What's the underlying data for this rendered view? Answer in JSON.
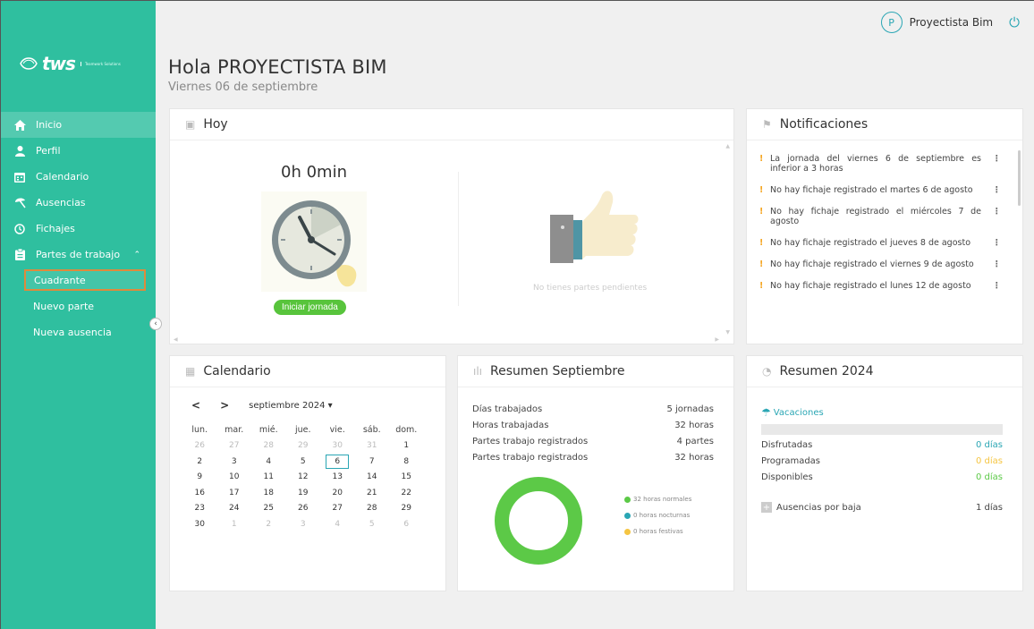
{
  "logo": {
    "name": "tws",
    "tagline": "Teamwork Solutions"
  },
  "nav": {
    "items": [
      {
        "label": "Inicio"
      },
      {
        "label": "Perfil"
      },
      {
        "label": "Calendario"
      },
      {
        "label": "Ausencias"
      },
      {
        "label": "Fichajes"
      },
      {
        "label": "Partes de trabajo"
      }
    ],
    "sub": [
      {
        "label": "Cuadrante"
      },
      {
        "label": "Nuevo parte"
      },
      {
        "label": "Nueva ausencia"
      }
    ]
  },
  "user": {
    "initial": "P",
    "name": "Proyectista Bim"
  },
  "header": {
    "greeting": "Hola PROYECTISTA BIM",
    "date": "Viernes 06 de septiembre"
  },
  "hoy": {
    "title": "Hoy",
    "time": "0h 0min",
    "start_button": "Iniciar jornada",
    "empty_text": "No tienes partes pendientes"
  },
  "notifications": {
    "title": "Notificaciones",
    "items": [
      "La jornada del viernes 6 de septiembre es inferior a 3 horas",
      "No hay fichaje registrado el martes 6 de agosto",
      "No hay fichaje registrado el miércoles 7 de agosto",
      "No hay fichaje registrado el jueves 8 de agosto",
      "No hay fichaje registrado el viernes 9 de agosto",
      "No hay fichaje registrado el lunes 12 de agosto"
    ]
  },
  "calendar": {
    "title": "Calendario",
    "month": "septiembre 2024",
    "weekdays": [
      "lun.",
      "mar.",
      "mié.",
      "jue.",
      "vie.",
      "sáb.",
      "dom."
    ],
    "weeks": [
      [
        "26",
        "27",
        "28",
        "29",
        "30",
        "31",
        "1"
      ],
      [
        "2",
        "3",
        "4",
        "5",
        "6",
        "7",
        "8"
      ],
      [
        "9",
        "10",
        "11",
        "12",
        "13",
        "14",
        "15"
      ],
      [
        "16",
        "17",
        "18",
        "19",
        "20",
        "21",
        "22"
      ],
      [
        "23",
        "24",
        "25",
        "26",
        "27",
        "28",
        "29"
      ],
      [
        "30",
        "1",
        "2",
        "3",
        "4",
        "5",
        "6"
      ]
    ]
  },
  "summary_month": {
    "title": "Resumen Septiembre",
    "rows": [
      {
        "label": "Días trabajados",
        "value": "5 jornadas"
      },
      {
        "label": "Horas trabajadas",
        "value": "32 horas"
      },
      {
        "label": "Partes trabajo registrados",
        "value": "4 partes"
      },
      {
        "label": "Partes trabajo registrados",
        "value": "32 horas"
      }
    ],
    "legend": [
      {
        "label": "32 horas normales",
        "color": "#5cc947"
      },
      {
        "label": "0 horas nocturnas",
        "color": "#2aa6b4"
      },
      {
        "label": "0 horas festivas",
        "color": "#f5c542"
      }
    ]
  },
  "summary_year": {
    "title": "Resumen 2024",
    "vacations_label": "Vacaciones",
    "rows": [
      {
        "label": "Disfrutadas",
        "value": "0 días",
        "color": "#2aa6b4"
      },
      {
        "label": "Programadas",
        "value": "0 días",
        "color": "#f5c542"
      },
      {
        "label": "Disponibles",
        "value": "0 días",
        "color": "#5cc947"
      }
    ],
    "absences_label": "Ausencias por baja",
    "absences_value": "1 días"
  },
  "colors": {
    "brand": "#2fbf9f",
    "accent": "#2aa6b4",
    "green": "#58c43c",
    "warning": "#f5a623"
  }
}
